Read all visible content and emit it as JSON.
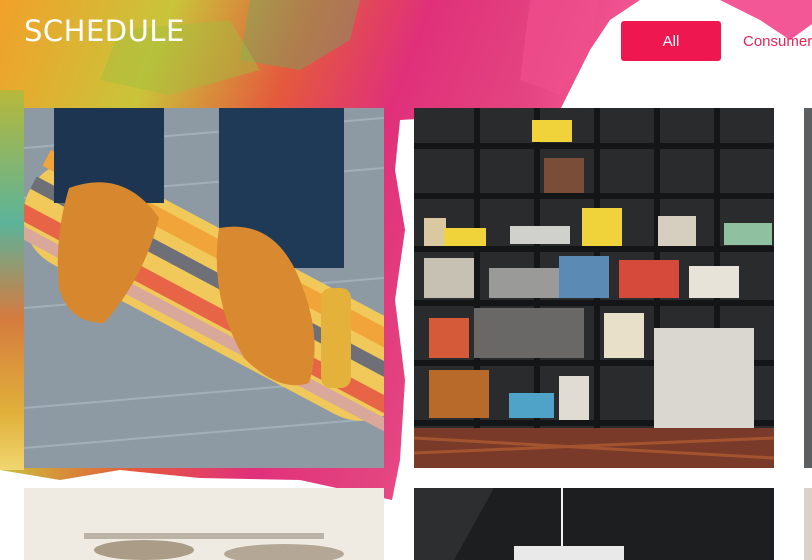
{
  "header": {
    "title": "SCHEDULE"
  },
  "filters": [
    {
      "label": "All",
      "active": true
    },
    {
      "label": "Consumer",
      "active": false
    }
  ],
  "colors": {
    "accent": "#ee1750"
  },
  "gallery": [
    {
      "subject": "skateboard-shoes"
    },
    {
      "subject": "bookshelf-room"
    },
    {
      "subject": "partial-right"
    },
    {
      "subject": "blurred-shoes"
    },
    {
      "subject": "hanging-lamp"
    }
  ]
}
